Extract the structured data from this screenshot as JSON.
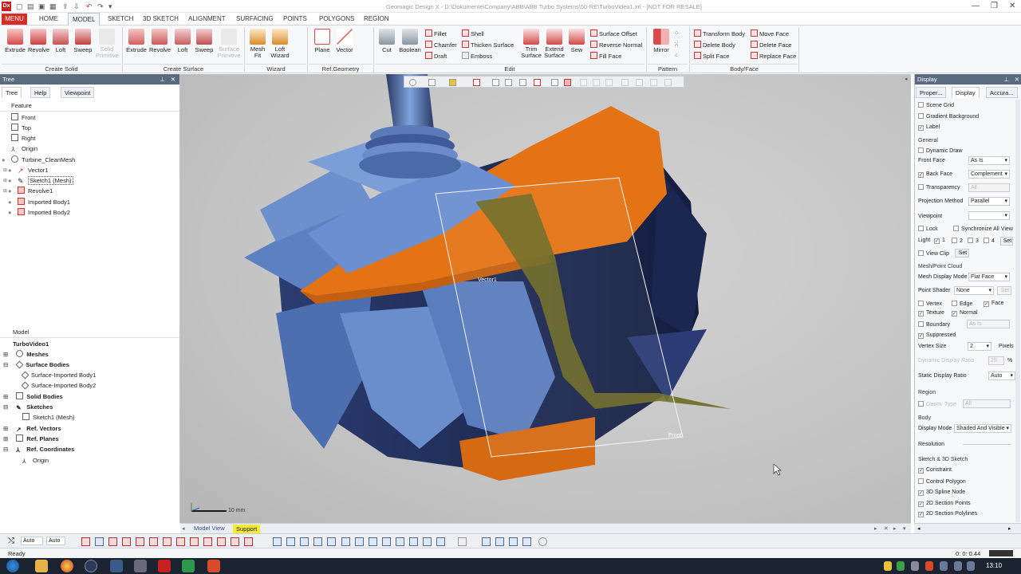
{
  "titlebar": {
    "logo": "Dx",
    "title": "Geomagic Design X - D:\\Dokumente\\Company\\ABB\\ABB Turbo Systems\\50-RE\\TurboVideo1.xrl - [NOT FOR RESALE]"
  },
  "menu": {
    "menu_button": "MENU",
    "tabs": [
      "HOME",
      "MODEL",
      "SKETCH",
      "3D SKETCH",
      "ALIGNMENT",
      "SURFACING",
      "POINTS",
      "POLYGONS",
      "REGION"
    ],
    "active_tab": "MODEL"
  },
  "ribbon": {
    "create_solid": {
      "title": "Create Solid",
      "buttons": [
        "Extrude",
        "Revolve",
        "Loft",
        "Sweep",
        "Solid Primitive"
      ]
    },
    "create_surface": {
      "title": "Create Surface",
      "buttons": [
        "Extrude",
        "Revolve",
        "Loft",
        "Sweep",
        "Surface Primitive"
      ]
    },
    "wizard": {
      "title": "Wizard",
      "buttons": [
        "Mesh Fit",
        "Loft Wizard"
      ]
    },
    "ref_geometry": {
      "title": "Ref.Geometry",
      "buttons": [
        "Plane",
        "Vector"
      ]
    },
    "edit": {
      "title": "Edit",
      "buttons": [
        "Cut",
        "Boolean"
      ],
      "small_col1": [
        "Fillet",
        "Chamfer",
        "Draft"
      ],
      "small_col2": [
        "Shell",
        "Thicken Surface",
        "Emboss"
      ],
      "buttons2": [
        "Trim Surface",
        "Extend Surface",
        "Sew"
      ],
      "small_col3": [
        "Surface Offset",
        "Reverse Normal",
        "Fill Face"
      ]
    },
    "pattern": {
      "title": "Pattern",
      "buttons": [
        "Mirror"
      ]
    },
    "body_face": {
      "title": "Body/Face",
      "small_col1": [
        "Transform Body",
        "Delete Body",
        "Split Face"
      ],
      "small_col2": [
        "Move Face",
        "Delete Face",
        "Replace Face"
      ]
    }
  },
  "tree_panel": {
    "header": "Tree",
    "tabs": [
      "Tree",
      "Help",
      "Viewpoint"
    ],
    "feature_header": "Feature",
    "features": [
      "Front",
      "Top",
      "Right",
      "Origin",
      "Turbine_CleanMesh",
      "Vector1",
      "Sketch1 (Mesh)",
      "Revolve1",
      "Imported Body1",
      "Imported Body2"
    ],
    "model_header": "Model",
    "model_root": "TurboVideo1",
    "model_items": [
      "Meshes",
      "Surface Bodies",
      "Surface-Imported Body1",
      "Surface-Imported Body2",
      "Solid Bodies",
      "Sketches",
      "Sketch1 (Mesh)",
      "Ref. Vectors",
      "Ref. Planes",
      "Ref. Coordinates",
      "Origin"
    ]
  },
  "viewport": {
    "labels": {
      "vector": "Vector1",
      "plane": "Front"
    },
    "scale": "10 mm",
    "colors": {
      "blade": "#5c7fc0",
      "blade_dark": "#1e2a52",
      "orange": "#e47315",
      "olive": "#6d6a24"
    }
  },
  "display_panel": {
    "header": "Display",
    "tabs": [
      "Proper...",
      "Display",
      "Accura..."
    ],
    "top_checks": [
      {
        "label": "Scene Grid",
        "checked": false
      },
      {
        "label": "Gradient Background",
        "checked": false
      },
      {
        "label": "Label",
        "checked": true
      }
    ],
    "general": {
      "title": "General",
      "dynamic_draw": "Dynamic Draw",
      "front_face_label": "Front Face",
      "front_face_value": "As Is",
      "back_face_label": "Back Face",
      "back_face_value": "Complement",
      "transparency_label": "Transparency",
      "transparency_value": "All",
      "projection_label": "Projection Method",
      "projection_value": "Parallel",
      "viewpoint_label": "Viewpoint",
      "lock": "Lock",
      "sync": "Synchronize All View",
      "light": "Light",
      "lights": [
        "1",
        "2",
        "3",
        "4"
      ],
      "set": "Set",
      "view_clip": "View Clip"
    },
    "mesh": {
      "title": "Mesh/Point Cloud",
      "mode_label": "Mesh Display Mode",
      "mode_value": "Flat Face",
      "shader_label": "Point Shader",
      "shader_value": "None",
      "set": "Set",
      "vertex": "Vertex",
      "edge": "Edge",
      "face": "Face",
      "texture": "Texture",
      "normal": "Normal",
      "boundary": "Boundary",
      "boundary_value": "As Is",
      "suppressed": "Suppressed",
      "vsize_label": "Vertex Size",
      "vsize_value": "2",
      "vsize_unit": "Pixels",
      "dyn_ratio_label": "Dynamic Display Ratio",
      "dyn_ratio_value": "25",
      "pct": "%",
      "static_ratio_label": "Static Display Ratio",
      "static_ratio_value": "Auto"
    },
    "region": {
      "title": "Region",
      "geom_label": "Geom. Type",
      "geom_value": "All"
    },
    "body": {
      "title": "Body",
      "mode_label": "Display Mode",
      "mode_value": "Shaded And Visible",
      "resolution": "Resolution"
    },
    "sketch": {
      "title": "Sketch & 3D Sketch",
      "items": [
        "Constraint",
        "Control Polygon",
        "3D Spline Node",
        "2D Section Points",
        "2D Section Polylines"
      ],
      "checked": [
        true,
        false,
        true,
        true,
        true
      ]
    }
  },
  "bottom": {
    "tabs": [
      "Model View",
      "Support"
    ],
    "auto1": "Auto",
    "auto2": "Auto"
  },
  "status": {
    "text": "Ready",
    "time": "0: 0: 0.44"
  },
  "taskbar": {
    "clock": "13:10"
  }
}
